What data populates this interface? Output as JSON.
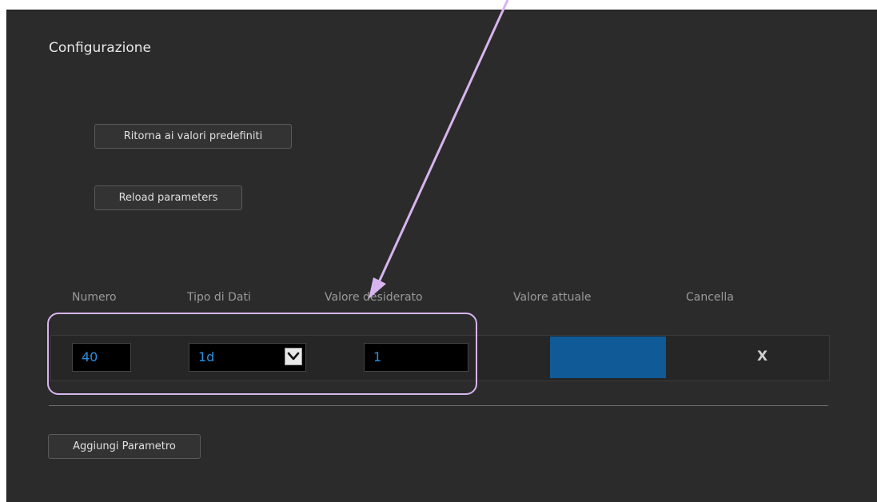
{
  "page": {
    "title": "Configurazione"
  },
  "buttons": {
    "reset_defaults": "Ritorna ai valori predefiniti",
    "reload": "Reload parameters",
    "add_parameter": "Aggiungi Parametro"
  },
  "table": {
    "headers": [
      "Numero",
      "Tipo di Dati",
      "Valore desiderato",
      "Valore attuale",
      "Cancella"
    ],
    "rows": [
      {
        "numero": "40",
        "tipo": "1d",
        "valore_desiderato": "1",
        "valore_attuale": "",
        "cancella": "X"
      }
    ]
  },
  "colors": {
    "panel_bg": "#2b2b2b",
    "input_text": "#2a8fe0",
    "actual_value_bar": "#105a97",
    "annotation": "#d7b4ee"
  },
  "icons": {
    "dropdown": "chevron-down-icon",
    "delete": "close-icon"
  }
}
